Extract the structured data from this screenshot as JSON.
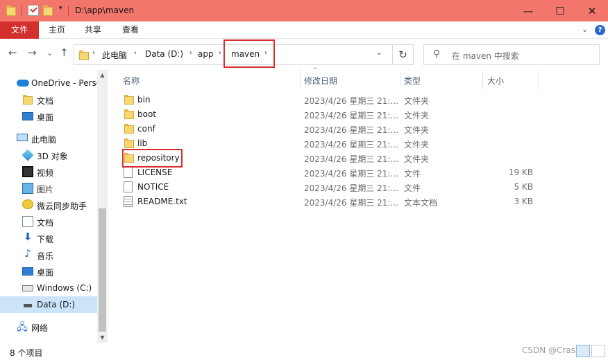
{
  "window": {
    "title": "D:\\app\\maven",
    "minimize_glyph": "—",
    "maximize_glyph": "☐",
    "close_glyph": "✕",
    "quick_access_drop": "▾"
  },
  "ribbon": {
    "tabs": [
      "文件",
      "主页",
      "共享",
      "查看"
    ],
    "collapse_glyph": "⌄",
    "help_glyph": "?"
  },
  "nav": {
    "back_glyph": "←",
    "forward_glyph": "→",
    "recent_glyph": "⌄",
    "up_glyph": "↑",
    "breadcrumb": [
      "此电脑",
      "Data (D:)",
      "app",
      "maven"
    ],
    "crumb_separator": "›",
    "dropdown_glyph": "⌄",
    "refresh_glyph": "↻",
    "search_placeholder": "在 maven 中搜索",
    "search_glyph": "⚲"
  },
  "sidebar": {
    "items": [
      {
        "label": "OneDrive - Perso",
        "icon": "onedrive-icon"
      },
      {
        "label": "文档",
        "icon": "folder-icon"
      },
      {
        "label": "桌面",
        "icon": "desktop-icon"
      },
      {
        "label": "此电脑",
        "icon": "this-pc-icon"
      },
      {
        "label": "3D 对象",
        "icon": "3d-objects-icon"
      },
      {
        "label": "视频",
        "icon": "videos-icon"
      },
      {
        "label": "图片",
        "icon": "pictures-icon"
      },
      {
        "label": "微云同步助手",
        "icon": "weiyun-icon"
      },
      {
        "label": "文档",
        "icon": "documents-icon"
      },
      {
        "label": "下载",
        "icon": "downloads-icon"
      },
      {
        "label": "音乐",
        "icon": "music-icon"
      },
      {
        "label": "桌面",
        "icon": "desktop-icon"
      },
      {
        "label": "Windows (C:)",
        "icon": "drive-c-icon"
      },
      {
        "label": "Data (D:)",
        "icon": "drive-d-icon"
      },
      {
        "label": "网络",
        "icon": "network-icon"
      }
    ],
    "download_glyph": "⬇",
    "music_glyph": "♪",
    "network_glyph": "🖧",
    "scroll_up_glyph": "▲",
    "scroll_down_glyph": "▼"
  },
  "columns": {
    "name": "名称",
    "date": "修改日期",
    "type": "类型",
    "size": "大小",
    "sort_glyph": "^"
  },
  "files": [
    {
      "name": "bin",
      "date": "2023/4/26 星期三 21:...",
      "type": "文件夹",
      "size": "",
      "icon": "folder-icon"
    },
    {
      "name": "boot",
      "date": "2023/4/26 星期三 21:...",
      "type": "文件夹",
      "size": "",
      "icon": "folder-icon"
    },
    {
      "name": "conf",
      "date": "2023/4/26 星期三 21:...",
      "type": "文件夹",
      "size": "",
      "icon": "folder-icon"
    },
    {
      "name": "lib",
      "date": "2023/4/26 星期三 21:...",
      "type": "文件夹",
      "size": "",
      "icon": "folder-icon"
    },
    {
      "name": "repository",
      "date": "2023/4/26 星期三 21:...",
      "type": "文件夹",
      "size": "",
      "icon": "folder-icon"
    },
    {
      "name": "LICENSE",
      "date": "2023/4/26 星期三 21:...",
      "type": "文件",
      "size": "19 KB",
      "icon": "file-icon"
    },
    {
      "name": "NOTICE",
      "date": "2023/4/26 星期三 21:...",
      "type": "文件",
      "size": "5 KB",
      "icon": "file-icon"
    },
    {
      "name": "README.txt",
      "date": "2023/4/26 星期三 21:...",
      "type": "文本文档",
      "size": "3 KB",
      "icon": "text-file-icon"
    }
  ],
  "status": {
    "count": "8 个项目",
    "watermark": "CSDN @Crashcc..."
  },
  "colors": {
    "titlebar": "#f2766b",
    "file_tab": "#d32f2f",
    "highlight_box": "#d8302f",
    "selected": "#cce4f7"
  }
}
